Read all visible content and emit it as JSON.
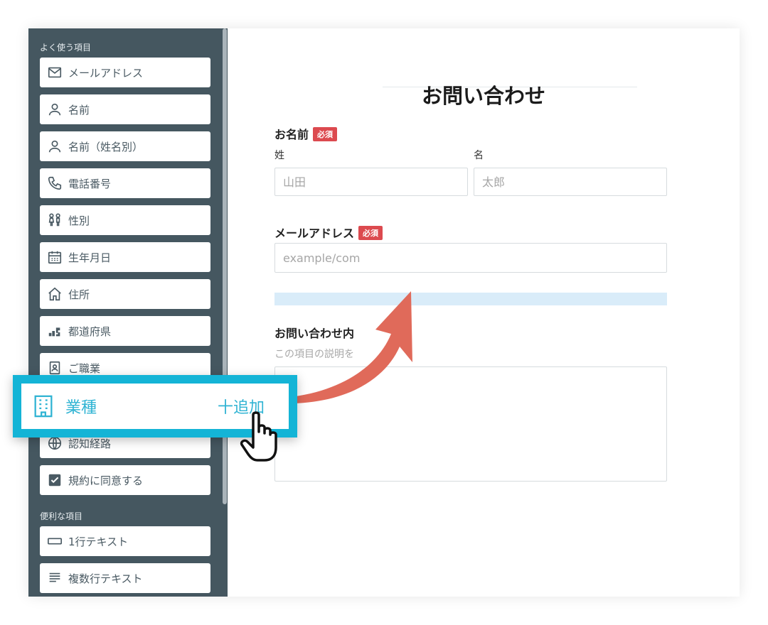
{
  "sidebar": {
    "section_frequent": "よく使う項目",
    "section_useful": "便利な項目",
    "items": [
      {
        "label": "メールアドレス",
        "icon": "mail-icon"
      },
      {
        "label": "名前",
        "icon": "person-icon"
      },
      {
        "label": "名前（姓名別）",
        "icon": "person-icon"
      },
      {
        "label": "電話番号",
        "icon": "phone-icon"
      },
      {
        "label": "性別",
        "icon": "gender-icon"
      },
      {
        "label": "生年月日",
        "icon": "calendar-icon"
      },
      {
        "label": "住所",
        "icon": "home-icon"
      },
      {
        "label": "都道府県",
        "icon": "map-icon"
      },
      {
        "label": "ご職業",
        "icon": "id-badge-icon"
      },
      {
        "label": "認知経路",
        "icon": "globe-icon"
      },
      {
        "label": "規約に同意する",
        "icon": "checkbox-icon"
      }
    ],
    "useful_items": [
      {
        "label": "1行テキスト",
        "icon": "single-line-icon"
      },
      {
        "label": "複数行テキスト",
        "icon": "multi-line-icon"
      }
    ]
  },
  "drag_item": {
    "label": "業種",
    "add_label": "十追加",
    "icon": "building-icon"
  },
  "form": {
    "title": "お問い合わせ",
    "name": {
      "label": "お名前",
      "required": "必須",
      "last_label": "姓",
      "first_label": "名",
      "last_placeholder": "山田",
      "first_placeholder": "太郎"
    },
    "email": {
      "label": "メールアドレス",
      "required": "必須",
      "placeholder": "example/com"
    },
    "inquiry": {
      "label": "お問い合わせ内",
      "description": "この項目の説明を"
    }
  },
  "colors": {
    "sidebar_bg": "#455760",
    "accent_cyan": "#14b4d6",
    "required_red": "#dc4a4f",
    "arrow": "#e06a5a",
    "dropzone": "#d9ecf9"
  }
}
